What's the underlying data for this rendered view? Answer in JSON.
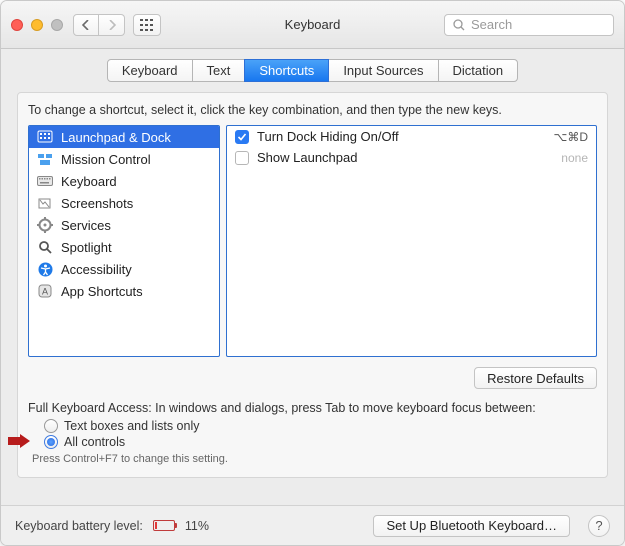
{
  "window_title": "Keyboard",
  "search_placeholder": "Search",
  "tabs": [
    "Keyboard",
    "Text",
    "Shortcuts",
    "Input Sources",
    "Dictation"
  ],
  "active_tab": 2,
  "instruction": "To change a shortcut, select it, click the key combination, and then type the new keys.",
  "categories": [
    {
      "label": "Launchpad & Dock",
      "icon": "launchpad"
    },
    {
      "label": "Mission Control",
      "icon": "mission"
    },
    {
      "label": "Keyboard",
      "icon": "keyboard"
    },
    {
      "label": "Screenshots",
      "icon": "screenshots"
    },
    {
      "label": "Services",
      "icon": "services"
    },
    {
      "label": "Spotlight",
      "icon": "spotlight"
    },
    {
      "label": "Accessibility",
      "icon": "accessibility"
    },
    {
      "label": "App Shortcuts",
      "icon": "app"
    }
  ],
  "selected_category": 0,
  "shortcuts": [
    {
      "checked": true,
      "label": "Turn Dock Hiding On/Off",
      "keys": "⌥⌘D"
    },
    {
      "checked": false,
      "label": "Show Launchpad",
      "keys": "none"
    }
  ],
  "restore_label": "Restore Defaults",
  "access_title": "Full Keyboard Access: In windows and dialogs, press Tab to move keyboard focus between:",
  "radio_options": [
    "Text boxes and lists only",
    "All controls"
  ],
  "selected_radio": 1,
  "access_hint": "Press Control+F7 to change this setting.",
  "battery_label": "Keyboard battery level:",
  "battery_percent": "11%",
  "setup_label": "Set Up Bluetooth Keyboard…",
  "help_glyph": "?"
}
